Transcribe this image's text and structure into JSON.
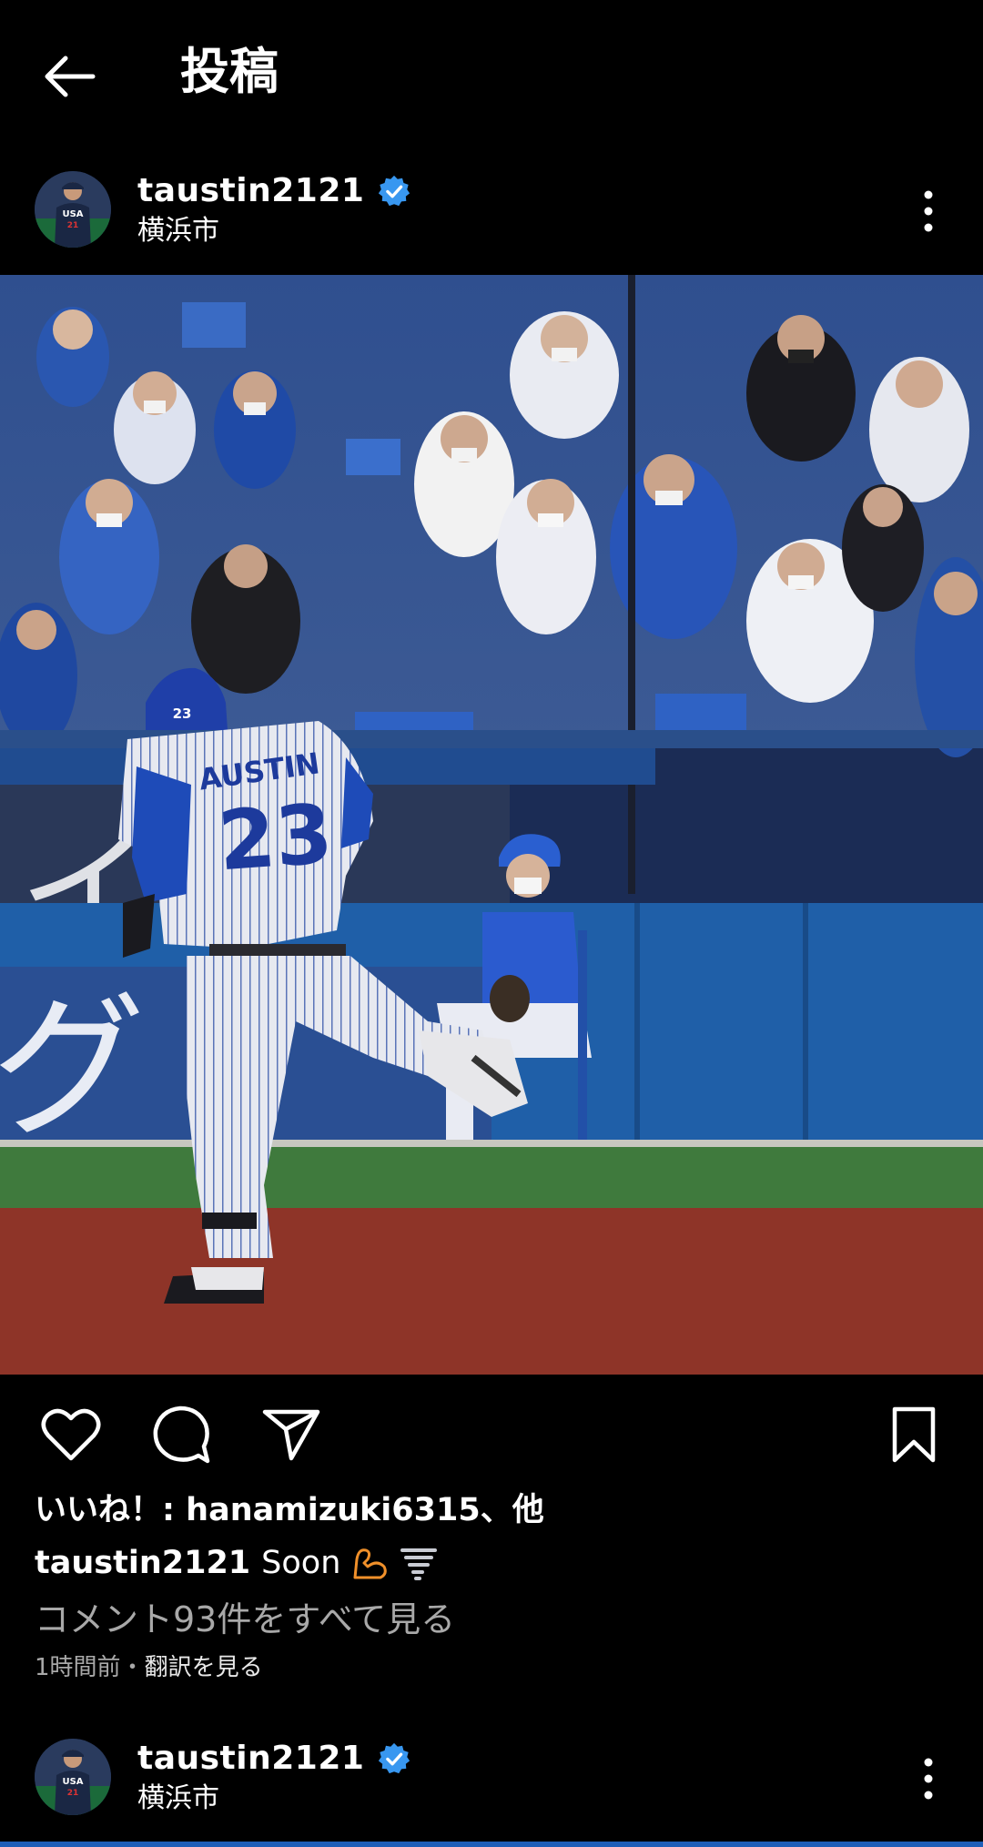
{
  "header": {
    "title": "投稿"
  },
  "post": {
    "username": "taustin2121",
    "location": "横浜市",
    "likes_text": "いいね！: hanamizuki6315、他",
    "caption_user": "taustin2121",
    "caption_text": "Soon",
    "caption_emojis": [
      "flexed-biceps-icon",
      "tornado-icon"
    ],
    "view_comments": "コメント93件をすべて見る",
    "time_ago": "1時間前",
    "separator": "・",
    "translate": "翻訳を見る"
  },
  "next_post": {
    "username": "taustin2121",
    "location": "横浜市"
  },
  "photo": {
    "jersey_name": "AUSTIN",
    "jersey_number": "23",
    "helmet_number": "23",
    "banner_text": "イ   チ",
    "wall_text": "グ"
  },
  "avatar": {
    "text": "USA",
    "number": "21"
  },
  "colors": {
    "background": "#000000",
    "verified": "#3897f0",
    "secondary_text": "#a8a8a8"
  }
}
